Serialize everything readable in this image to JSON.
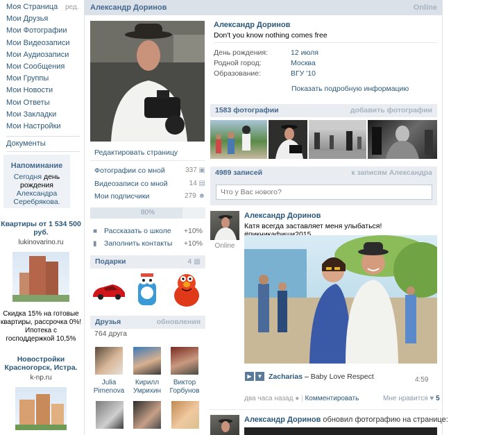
{
  "nav": {
    "edit": "ред.",
    "items": [
      "Моя Страница",
      "Мои Друзья",
      "Мои Фотографии",
      "Мои Видеозаписи",
      "Мои Аудиозаписи",
      "Мои Сообщения",
      "Мои Группы",
      "Мои Новости",
      "Мои Ответы",
      "Мои Закладки",
      "Мои Настройки"
    ],
    "documents": "Документы"
  },
  "reminder": {
    "title": "Напоминание",
    "today": "Сегодня",
    "birthday": "день рождения",
    "name": "Александра Серебрякова."
  },
  "ads": [
    {
      "title": "Квартиры от 1 534 500 руб.",
      "site": "lukinovarino.ru",
      "text": "Скидка 15% на готовые квартиры, рассрочка 0%! Ипотека с господдержкой 10,5%"
    },
    {
      "title": "Новостройки Красногорск, Истра.",
      "site": "k-np.ru"
    }
  ],
  "header": {
    "name": "Александр Доринов",
    "status": "Online"
  },
  "profile": {
    "name": "Александр Доринов",
    "quote": "Don't you know nothing comes free",
    "fields": [
      {
        "label": "День рождения:",
        "value": "12 июля"
      },
      {
        "label": "Родной город:",
        "value": "Москва"
      },
      {
        "label": "Образование:",
        "value": "ВГУ '10"
      }
    ],
    "more_info": "Показать подробную информацию",
    "edit_page": "Редактировать страницу",
    "links": [
      {
        "label": "Фотографии со мной",
        "count": "337"
      },
      {
        "label": "Видеозаписи со мной",
        "count": "14"
      },
      {
        "label": "Мои подписчики",
        "count": "279"
      }
    ],
    "progress": 80,
    "progress_label": "80%",
    "tips": [
      {
        "label": "Рассказать о школе",
        "value": "+10%"
      },
      {
        "label": "Заполнить контакты",
        "value": "+10%"
      }
    ],
    "gifts": {
      "title": "Подарки",
      "count": "4"
    },
    "friends": {
      "title": "Друзья",
      "updates": "обновления",
      "count": "764 друга",
      "list": [
        {
          "first": "Julia",
          "last": "Pimenova"
        },
        {
          "first": "Кирилл",
          "last": "Умрихин"
        },
        {
          "first": "Виктор",
          "last": "Горбунов"
        }
      ]
    }
  },
  "photos": {
    "title": "1583 фотографии",
    "add": "добавить фотографии"
  },
  "wall": {
    "title": "4989 записей",
    "to_wall": "к записям Александра",
    "placeholder": "Что у Вас нового?",
    "post1": {
      "author": "Александр Доринов",
      "online": "Online",
      "text": "Катя всегда заставляет меня улыбаться! #пикникафиши2015",
      "audio_artist": "Zacharias",
      "audio_sep": " – ",
      "audio_title": "Baby Love Respect",
      "duration": "4:59",
      "time": "два часа назад",
      "comment": "Комментировать",
      "like": "Мне нравится",
      "likes": "5"
    },
    "post2": {
      "author": "Александр Доринов",
      "action": "обновил фотографию на странице:"
    }
  },
  "colors": {
    "link": "#2b587a",
    "header_bg": "#dae1e8",
    "bar_bg": "#e9edf1"
  }
}
